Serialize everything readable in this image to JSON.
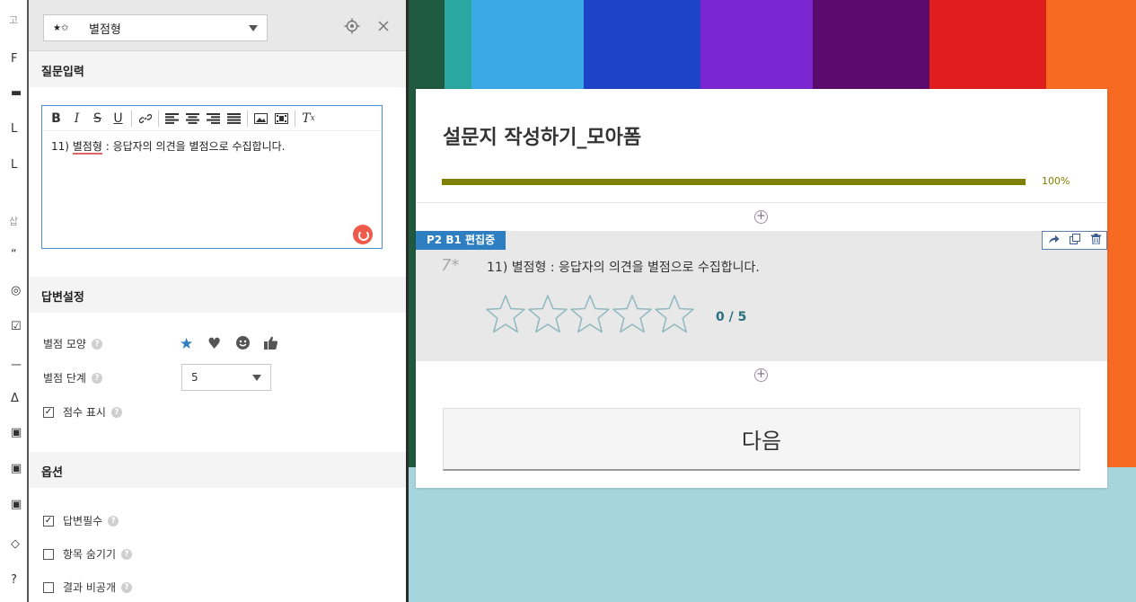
{
  "left_panel": {
    "type_selector": {
      "icon_text": "★✩",
      "label": "별점형"
    },
    "question_section": {
      "title": "질문입력",
      "editor": {
        "toolbar": [
          "B",
          "I",
          "S",
          "U",
          "link",
          "align-left",
          "align-center",
          "align-right",
          "align-justify",
          "image",
          "video",
          "clear-format"
        ],
        "content_prefix": "11) ",
        "content_word": "별점형",
        "content_rest": " : 응답자의 의견을 별점으로 수집합니다."
      }
    },
    "answer_section": {
      "title": "답변설정",
      "shape_label": "별점 모양",
      "shapes": [
        "star",
        "heart",
        "smile",
        "thumbs-up"
      ],
      "selected_shape": "star",
      "step_label": "별점 단계",
      "step_value": "5",
      "score_label": "점수 표시",
      "score_checked": true
    },
    "options_section": {
      "title": "옵션",
      "items": [
        {
          "label": "답변필수",
          "checked": true
        },
        {
          "label": "항목 숨기기",
          "checked": false
        },
        {
          "label": "결과 비공개",
          "checked": false
        }
      ]
    }
  },
  "survey": {
    "title": "설문지 작성하기_모아폼",
    "progress_text": "100%",
    "progress_value": 1.0,
    "progress_color": "#808000",
    "question": {
      "badge": "P2 B1 편집중",
      "number": "7*",
      "text": "11) 별점형 : 응답자의 의견을 별점으로 수집합니다.",
      "star_count": 5,
      "rating": 0,
      "score_text": "0 / 5"
    },
    "next_label": "다음"
  },
  "edge_strip": [
    "고",
    "F",
    "▬",
    "L",
    "L",
    "삽",
    "“",
    "◎",
    "☑",
    "ㅡ",
    "Δ",
    "▣",
    "▣",
    "▣",
    "◇",
    "?"
  ]
}
